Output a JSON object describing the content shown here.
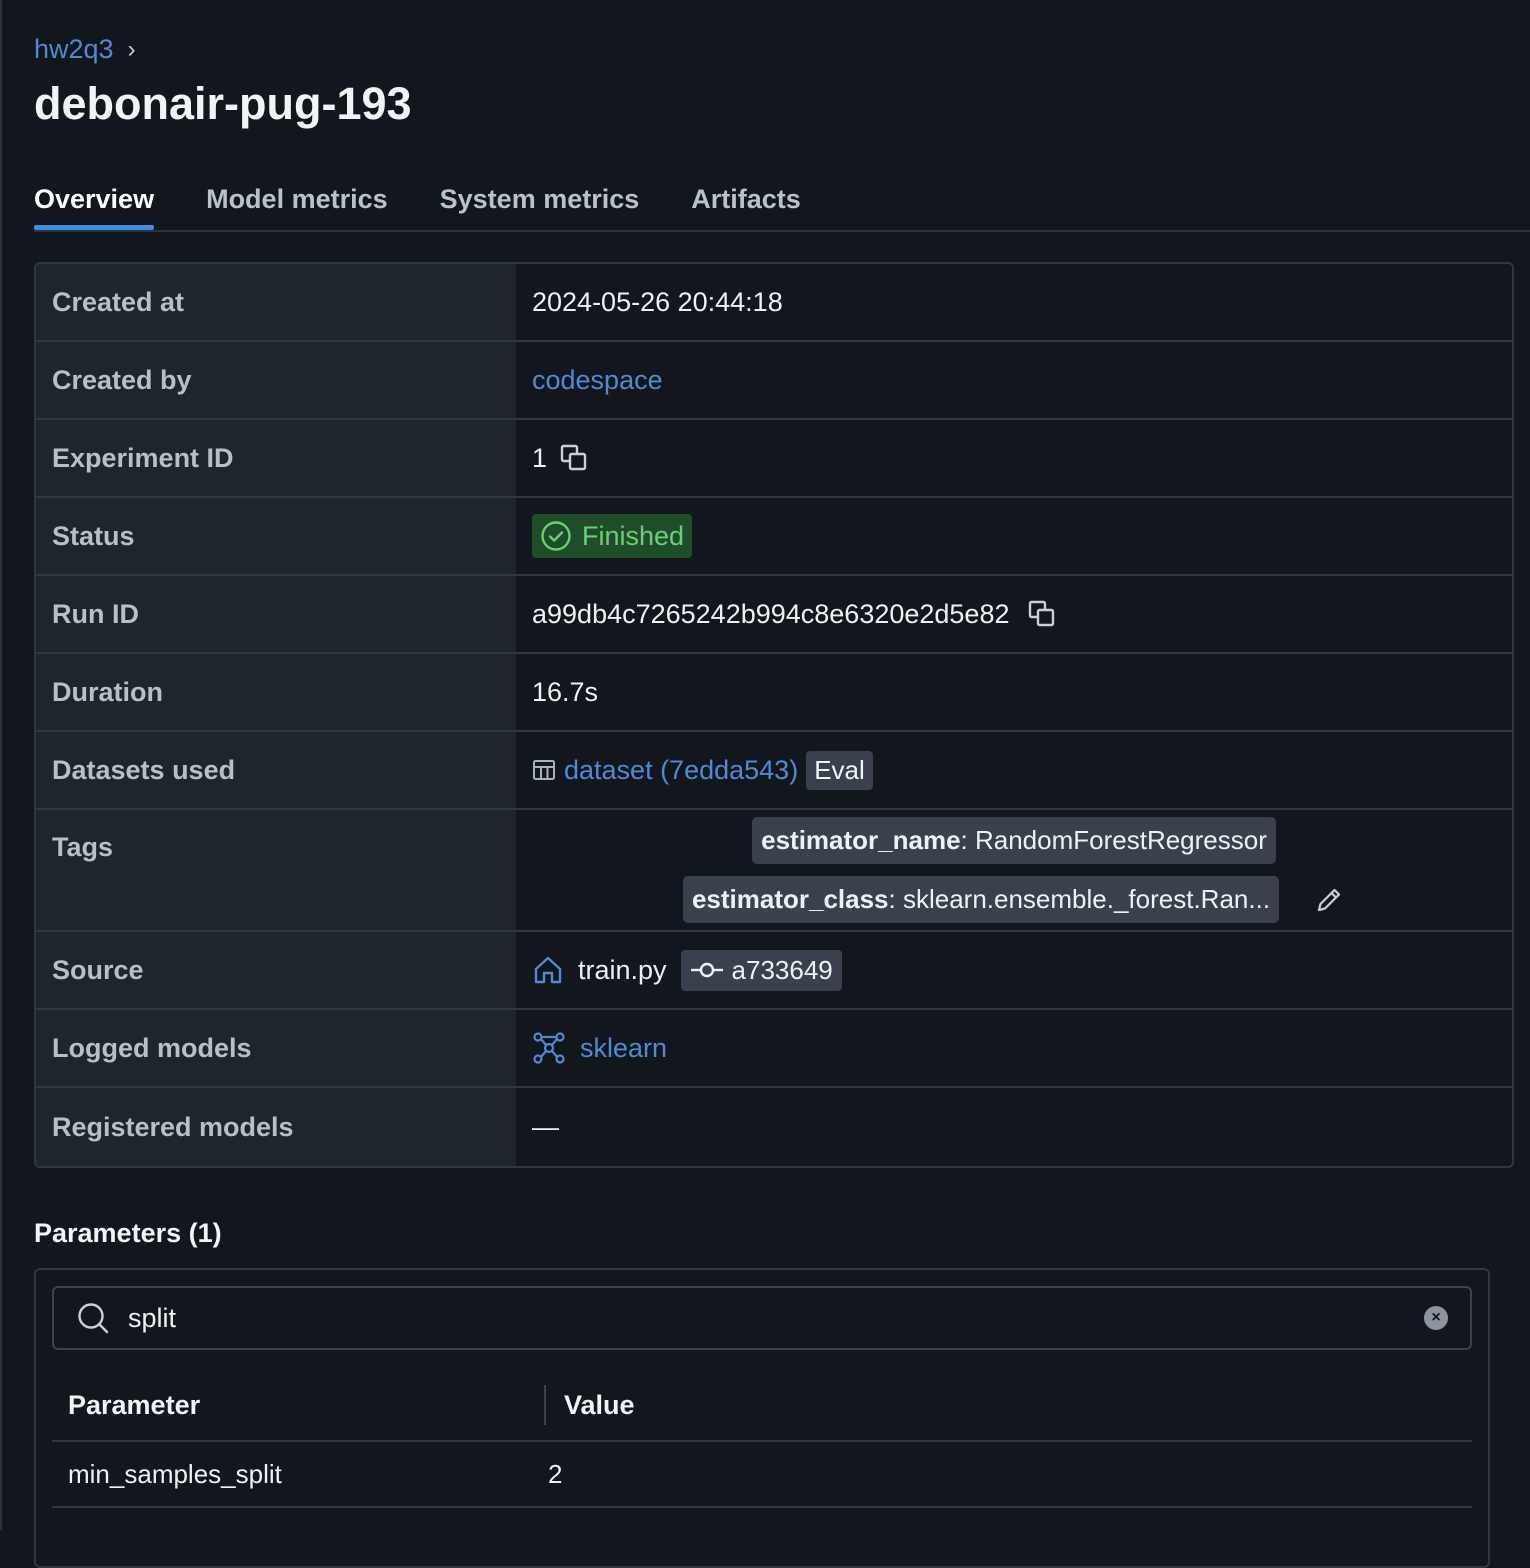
{
  "breadcrumb": {
    "parent": "hw2q3",
    "separator": "›"
  },
  "title": "debonair-pug-193",
  "tabs": [
    "Overview",
    "Model metrics",
    "System metrics",
    "Artifacts"
  ],
  "details": {
    "created_at": {
      "label": "Created at",
      "value": "2024-05-26 20:44:18"
    },
    "created_by": {
      "label": "Created by",
      "value": "codespace"
    },
    "experiment_id": {
      "label": "Experiment ID",
      "value": "1"
    },
    "status": {
      "label": "Status",
      "value": "Finished"
    },
    "run_id": {
      "label": "Run ID",
      "value": "a99db4c7265242b994c8e6320e2d5e82"
    },
    "duration": {
      "label": "Duration",
      "value": "16.7s"
    },
    "datasets_used": {
      "label": "Datasets used",
      "value": "dataset (7edda543)",
      "badge": "Eval"
    },
    "tags": {
      "label": "Tags",
      "items": [
        {
          "key": "estimator_name",
          "value": "RandomForestRegressor"
        },
        {
          "key": "estimator_class",
          "value": "sklearn.ensemble._forest.Ran..."
        }
      ]
    },
    "source": {
      "label": "Source",
      "value": "train.py",
      "commit": "a733649"
    },
    "logged_models": {
      "label": "Logged models",
      "value": "sklearn"
    },
    "registered_models": {
      "label": "Registered models",
      "value": "—"
    }
  },
  "parameters": {
    "title": "Parameters (1)",
    "search_value": "split",
    "columns": [
      "Parameter",
      "Value"
    ],
    "rows": [
      {
        "name": "min_samples_split",
        "value": "2"
      }
    ]
  },
  "colors": {
    "accent": "#3e8ee0",
    "link": "#4f8bd2",
    "status_bg": "#1f4d2a",
    "status_fg": "#6ccf74",
    "background": "#11171d"
  }
}
